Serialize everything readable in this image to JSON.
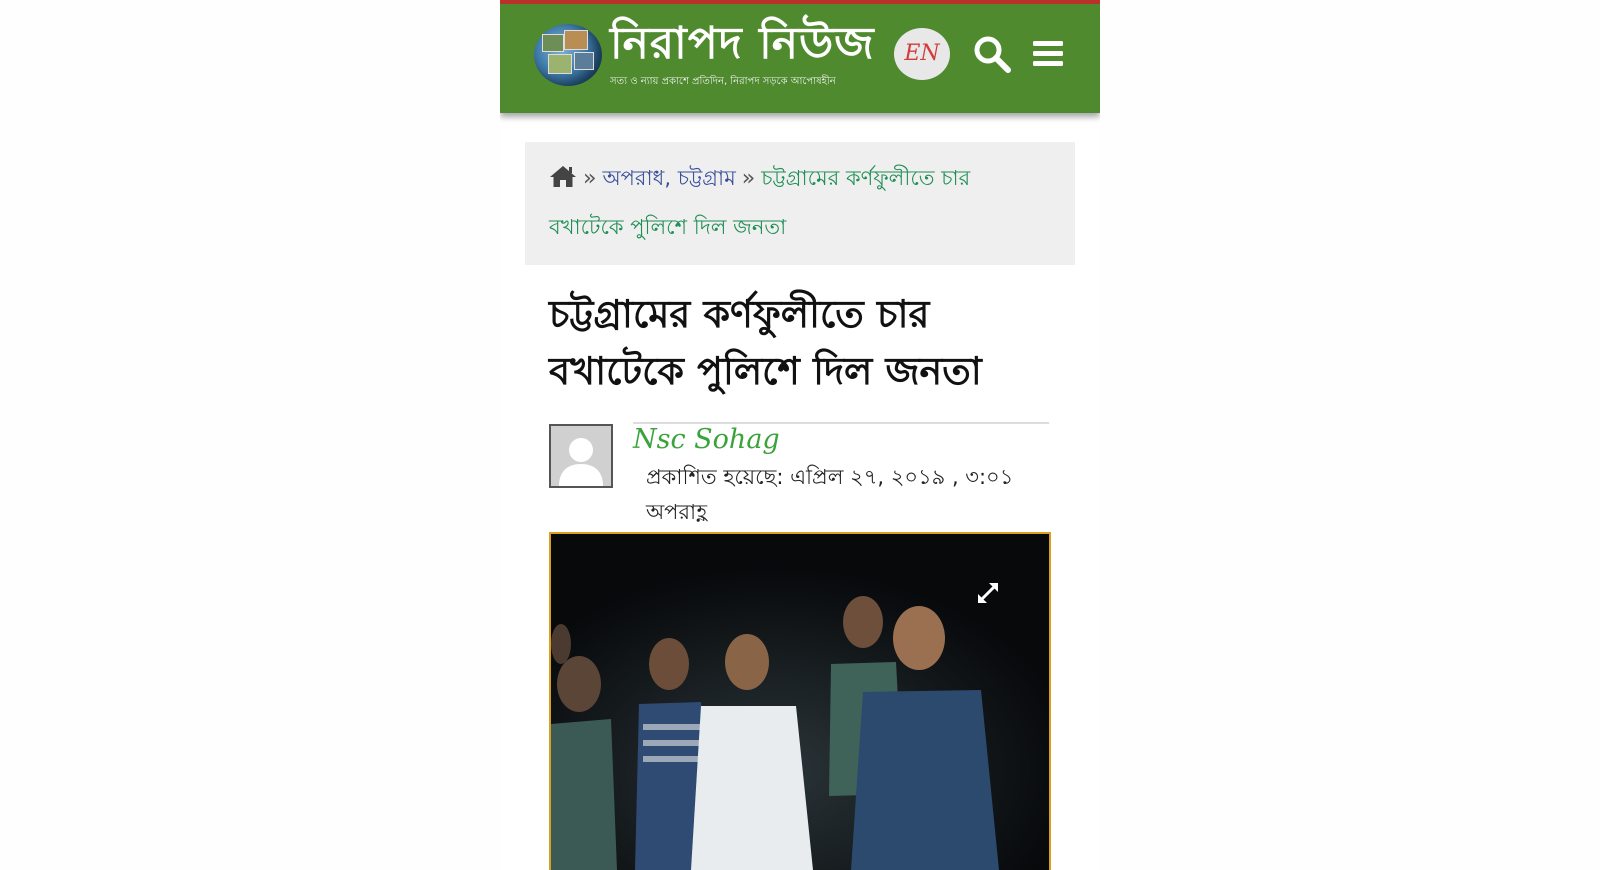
{
  "header": {
    "site_title": "নিরাপদ নিউজ",
    "tagline": "সত্য ও ন্যায় প্রকাশে প্রতিদিন, নিরাপদ সড়কে আপোষহীন",
    "lang_button": "EN",
    "logo_icon": "globe-photo-collage-logo",
    "search_icon": "search-icon",
    "menu_icon": "hamburger-menu-icon"
  },
  "breadcrumb": {
    "home_icon": "home-icon",
    "separator": "»",
    "category_1": "অপরাধ",
    "category_sep": ", ",
    "category_2": "চট্টগ্রাম",
    "current": "চট্টগ্রামের কর্ণফুলীতে চার বখাটেকে পুলিশে দিল জনতা"
  },
  "article": {
    "title": "চট্টগ্রামের কর্ণফুলীতে চার বখাটেকে পুলিশে দিল জনতা",
    "author": "Nsc Sohag",
    "published": "প্রকাশিত হয়েছে: এপ্রিল ২৭, ২০১৯ , ৩:০১ অপরাহ্ণ",
    "image_expand_icon": "expand-icon"
  },
  "colors": {
    "header_green": "#4f8a2e",
    "header_top_border": "#b8322a",
    "breadcrumb_link": "#3a4f9a",
    "breadcrumb_current": "#1f8e55",
    "author_green": "#3aa33a",
    "photo_border": "#d9a020"
  }
}
